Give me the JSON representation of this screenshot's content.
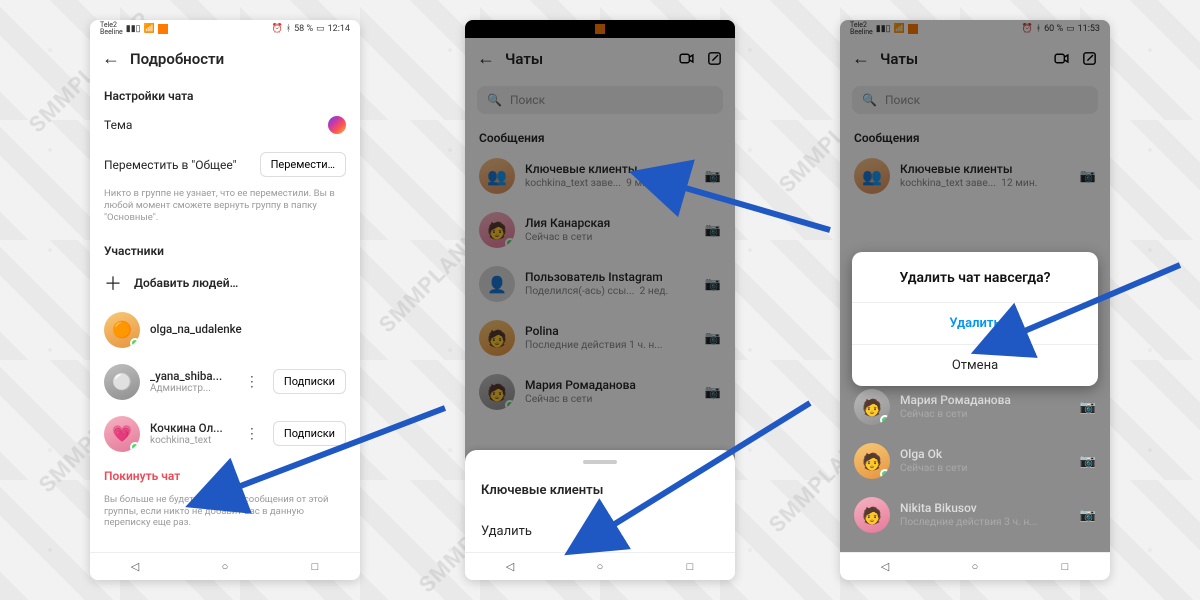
{
  "watermark": "SMMPLANNER",
  "phone1": {
    "status": {
      "carrier_top": "Tele2",
      "carrier_bottom": "Beeline",
      "batt": "58 %",
      "time": "12:14"
    },
    "title": "Подробности",
    "section_settings": "Настройки чата",
    "theme_label": "Тема",
    "move_label": "Переместить в \"Общее\"",
    "move_btn": "Перемести…",
    "move_hint": "Никто в группе не узнает, что ее переместили. Вы в любой момент сможете вернуть группу в папку \"Основные\".",
    "section_members": "Участники",
    "add_people": "Добавить людей…",
    "follow_btn": "Подписки",
    "members": [
      {
        "name": "olga_na_udalenke",
        "sub": ""
      },
      {
        "name": "_yana_shiba...",
        "sub": "Администр..."
      },
      {
        "name": "Кочкина Ол...",
        "sub": "kochkina_text"
      }
    ],
    "leave_chat": "Покинуть чат",
    "leave_hint": "Вы больше не будете получать сообщения от этой группы, если никто не добавит вас в данную переписку еще раз."
  },
  "phone2": {
    "title": "Чаты",
    "search_placeholder": "Поиск",
    "section_messages": "Сообщения",
    "chats": [
      {
        "name": "Ключевые клиенты",
        "sub": "kochkina_text заве...",
        "time": "9 мин."
      },
      {
        "name": "Лия Канарская",
        "sub": "Сейчас в сети",
        "time": ""
      },
      {
        "name": "Пользователь Instagram",
        "sub": "Поделился(-ась) ссы...",
        "time": "2 нед."
      },
      {
        "name": "Polina",
        "sub": "Последние действия 1 ч. н...",
        "time": ""
      },
      {
        "name": "Мария Ромаданова",
        "sub": "Сейчас в сети",
        "time": ""
      }
    ],
    "sheet_title": "Ключевые клиенты",
    "sheet_delete": "Удалить"
  },
  "phone3": {
    "status": {
      "carrier_top": "Tele2",
      "carrier_bottom": "Beeline",
      "batt": "60 %",
      "time": "11:53"
    },
    "title": "Чаты",
    "search_placeholder": "Поиск",
    "section_messages": "Сообщения",
    "chats": [
      {
        "name": "Ключевые клиенты",
        "sub": "kochkina_text заве...",
        "time": "12 мин."
      },
      {
        "name": "Мария Ромаданова",
        "sub": "Сейчас в сети",
        "time": ""
      },
      {
        "name": "Olga Ok",
        "sub": "Сейчас в сети",
        "time": ""
      },
      {
        "name": "Nikita Bikusov",
        "sub": "Последние действия 3 ч. н...",
        "time": ""
      }
    ],
    "dialog": {
      "title": "Удалить чат навсегда?",
      "delete": "Удалить",
      "cancel": "Отмена"
    },
    "camera": "Камера"
  }
}
